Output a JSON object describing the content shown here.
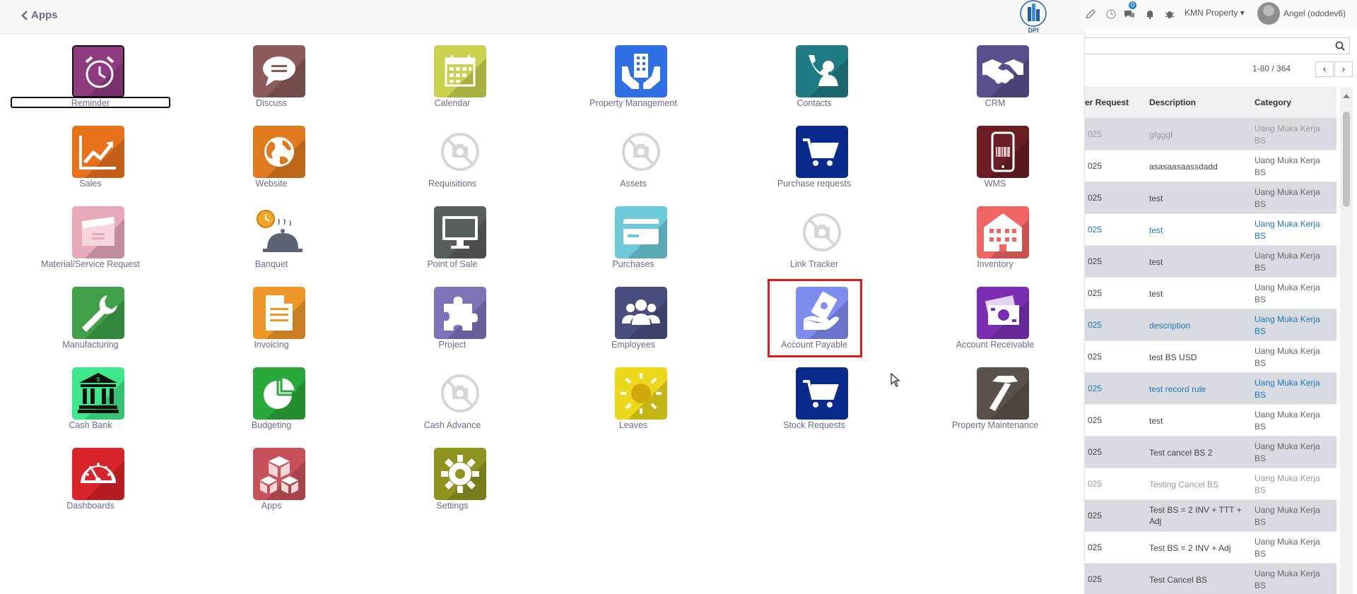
{
  "header": {
    "back_label": "Apps",
    "logo_text": "DPI"
  },
  "apps": [
    {
      "label": "Reminder",
      "icon": "alarm-clock-icon",
      "color": "#8e3a7f"
    },
    {
      "label": "Discuss",
      "icon": "chat-bubble-icon",
      "color": "#8b5a5a"
    },
    {
      "label": "Calendar",
      "icon": "calendar-icon",
      "color": "#c8d24e"
    },
    {
      "label": "Property Management",
      "icon": "building-in-hands-icon",
      "color": "#2f6fe4"
    },
    {
      "label": "Contacts",
      "icon": "contact-phone-icon",
      "color": "#1f7c84"
    },
    {
      "label": "CRM",
      "icon": "handshake-icon",
      "color": "#5a4f8e"
    },
    {
      "label": "Sales",
      "icon": "trend-chart-icon",
      "color": "#e8711c"
    },
    {
      "label": "Website",
      "icon": "globe-icon",
      "color": "#e07a1e"
    },
    {
      "label": "Requisitions",
      "icon": "no-image-camera-icon",
      "color": "#dddddd"
    },
    {
      "label": "Assets",
      "icon": "no-image-camera-icon",
      "color": "#dddddd"
    },
    {
      "label": "Purchase requests",
      "icon": "shopping-cart-icon",
      "color": "#0a2a8c"
    },
    {
      "label": "WMS",
      "icon": "barcode-phone-icon",
      "color": "#6b1d24"
    },
    {
      "label": "Material/Service Request",
      "icon": "box-request-icon",
      "color": "#e8a9b9"
    },
    {
      "label": "Banquet",
      "icon": "cloche-clock-icon",
      "color": "#ffffff"
    },
    {
      "label": "Point of Sale",
      "icon": "monitor-icon",
      "color": "#565e5e"
    },
    {
      "label": "Purchases",
      "icon": "credit-card-icon",
      "color": "#6ccad8"
    },
    {
      "label": "Link Tracker",
      "icon": "no-image-camera-icon",
      "color": "#dddddd"
    },
    {
      "label": "Inventory",
      "icon": "warehouse-icon",
      "color": "#f06464"
    },
    {
      "label": "Manufacturing",
      "icon": "wrench-icon",
      "color": "#3fa048"
    },
    {
      "label": "Invoicing",
      "icon": "document-icon",
      "color": "#f0972a"
    },
    {
      "label": "Project",
      "icon": "puzzle-icon",
      "color": "#7b73b8"
    },
    {
      "label": "Employees",
      "icon": "people-group-icon",
      "color": "#4a4e7e"
    },
    {
      "label": "Account Payable",
      "icon": "hand-money-icon",
      "color": "#7f8cf0"
    },
    {
      "label": "Account Receivable",
      "icon": "money-bill-icon",
      "color": "#7a2fb3"
    },
    {
      "label": "Cash Bank",
      "icon": "bank-icon",
      "color": "#3ee88a"
    },
    {
      "label": "Budgeting",
      "icon": "pie-chart-icon",
      "color": "#2aa83a"
    },
    {
      "label": "Cash Advance",
      "icon": "no-image-camera-icon",
      "color": "#dddddd"
    },
    {
      "label": "Leaves",
      "icon": "sun-icon",
      "color": "#ecd81c"
    },
    {
      "label": "Stock Requests",
      "icon": "shopping-cart-icon",
      "color": "#0a2a8c"
    },
    {
      "label": "Property Maintenance",
      "icon": "hammer-icon",
      "color": "#5a524c"
    },
    {
      "label": "Dashboards",
      "icon": "gauge-icon",
      "color": "#d8232a"
    },
    {
      "label": "Apps",
      "icon": "cubes-icon",
      "color": "#c8505a"
    },
    {
      "label": "Settings",
      "icon": "gear-icon",
      "color": "#8f9420"
    }
  ],
  "topbar": {
    "company": "KMN Property",
    "user": "Angel (ododev6)",
    "badge_count": "0"
  },
  "list": {
    "pager": "1-80 / 364",
    "columns": [
      "er Request",
      "Description",
      "Category"
    ],
    "rows": [
      {
        "num": "025",
        "description": "gfgggf",
        "category": "Uang Muka Kerja BS",
        "style": "grey"
      },
      {
        "num": "025",
        "description": "asasaasaassdadd",
        "category": "Uang Muka Kerja BS",
        "style": "normal"
      },
      {
        "num": "025",
        "description": "test",
        "category": "Uang Muka Kerja BS",
        "style": "normal"
      },
      {
        "num": "025",
        "description": "test",
        "category": "Uang Muka Kerja BS",
        "style": "blue"
      },
      {
        "num": "025",
        "description": "test",
        "category": "Uang Muka Kerja BS",
        "style": "normal"
      },
      {
        "num": "025",
        "description": "test",
        "category": "Uang Muka Kerja BS",
        "style": "normal"
      },
      {
        "num": "025",
        "description": "description",
        "category": "Uang Muka Kerja BS",
        "style": "blue"
      },
      {
        "num": "025",
        "description": "test BS USD",
        "category": "Uang Muka Kerja BS",
        "style": "normal"
      },
      {
        "num": "025",
        "description": "test record rule",
        "category": "Uang Muka Kerja BS",
        "style": "blue"
      },
      {
        "num": "025",
        "description": "test",
        "category": "Uang Muka Kerja BS",
        "style": "normal"
      },
      {
        "num": "025",
        "description": "Test cancel BS 2",
        "category": "Uang Muka Kerja BS",
        "style": "normal"
      },
      {
        "num": "025",
        "description": "Testing Cancel BS",
        "category": "Uang Muka Kerja BS",
        "style": "grey"
      },
      {
        "num": "025",
        "description": "Test BS = 2 INV + TTT + Adj",
        "category": "Uang Muka Kerja BS",
        "style": "normal"
      },
      {
        "num": "025",
        "description": "Test BS = 2 INV + Adj",
        "category": "Uang Muka Kerja BS",
        "style": "normal"
      },
      {
        "num": "025",
        "description": "Test Cancel BS",
        "category": "Uang Muka Kerja BS",
        "style": "normal"
      }
    ]
  }
}
